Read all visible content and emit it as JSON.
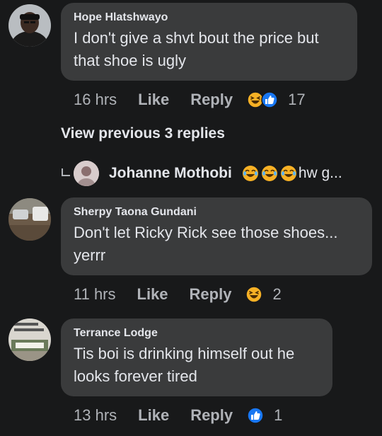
{
  "comments": [
    {
      "author": "Hope Hlatshwayo",
      "text_line1": "I don't give a shvt bout the price but",
      "text_line2": "that shoe is ugly",
      "time": "16 hrs",
      "like_label": "Like",
      "reply_label": "Reply",
      "reaction_icons": [
        "haha-icon",
        "like-icon"
      ],
      "reaction_count": "17"
    },
    {
      "author": "Sherpy Taona Gundani",
      "text_line1": "Don't let Ricky Rick see those shoes...",
      "text_line2": "yerrr",
      "time": "11 hrs",
      "like_label": "Like",
      "reply_label": "Reply",
      "reaction_icons": [
        "haha-icon"
      ],
      "reaction_count": "2"
    },
    {
      "author": "Terrance Lodge",
      "text_line1": "Tis boi is drinking himself out he",
      "text_line2": "looks forever tired",
      "time": "13 hrs",
      "like_label": "Like",
      "reply_label": "Reply",
      "reaction_icons": [
        "like-icon"
      ],
      "reaction_count": "1"
    }
  ],
  "view_previous": "View previous 3 replies",
  "reply_preview": {
    "author": "Johanne Mothobi",
    "reaction_icons": [
      "haha-icon",
      "haha-icon",
      "haha-icon"
    ],
    "text": "hw g..."
  },
  "colors": {
    "background": "#18191a",
    "bubble": "#3a3b3c",
    "text": "#e4e6eb",
    "meta": "#b0b3b8",
    "like_blue": "#1877f2",
    "haha_yellow": "#f7b125"
  }
}
